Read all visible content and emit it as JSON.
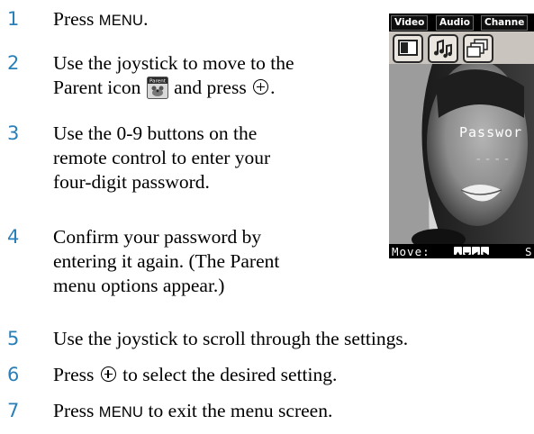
{
  "steps": [
    {
      "num": "1",
      "pre": "Press ",
      "key": "MENU",
      "post": "."
    },
    {
      "num": "2",
      "line1": "Use the joystick to move to the",
      "line2_pre": "Parent icon",
      "line2_post": "and press",
      "line2_end": "."
    },
    {
      "num": "3",
      "lines": [
        "Use the 0-9 buttons on the",
        "remote control to enter your",
        "four-digit password."
      ]
    },
    {
      "num": "4",
      "lines": [
        "Confirm your password by",
        "entering it again. (The Parent",
        "menu options appear.)"
      ]
    },
    {
      "num": "5",
      "text": "Use the joystick to scroll through the settings."
    },
    {
      "num": "6",
      "pre": "Press",
      "post": "to select the desired setting."
    },
    {
      "num": "7",
      "pre": "Press ",
      "key": "MENU",
      "post": " to exit the menu screen."
    }
  ],
  "parent_icon": {
    "name": "parent-icon",
    "label": "Parent"
  },
  "enter_icon": "enter-circle-plus-icon",
  "screen": {
    "tabs": [
      "Video",
      "Audio",
      "Channe"
    ],
    "menu_icons": [
      "picture-icon",
      "music-notes-icon",
      "channel-icon"
    ],
    "password_label": "Passwor",
    "password_dashes": "----",
    "move_label": "Move:",
    "status_extra": "S"
  },
  "colors": {
    "step_number": "#2a7fb8",
    "screen_bg": "#0a0a0a"
  }
}
